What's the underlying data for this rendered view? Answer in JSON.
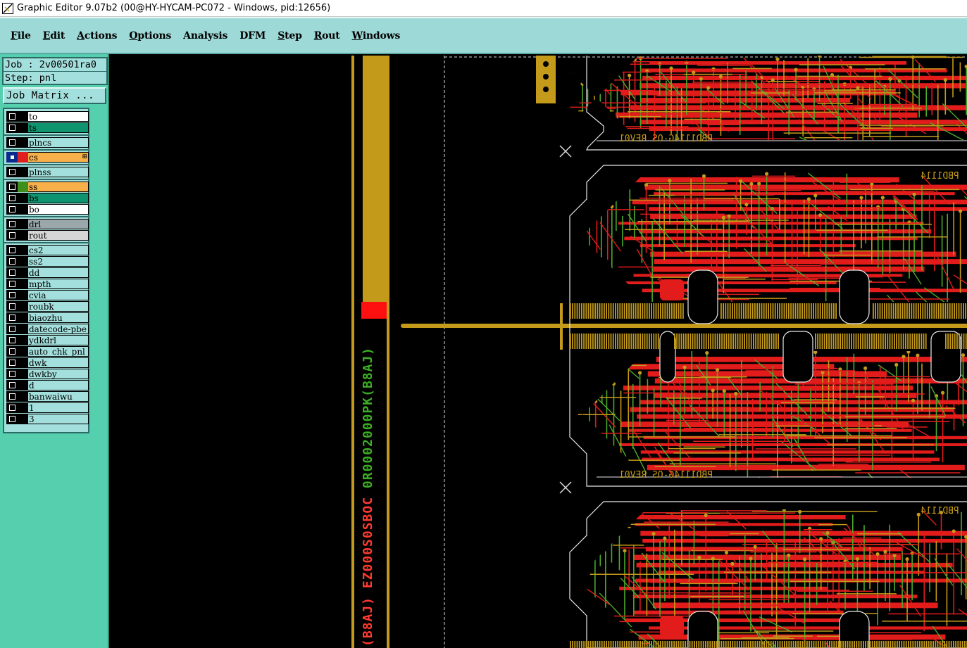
{
  "window": {
    "title": "Graphic Editor 9.07b2 (00@HY-HYCAM-PC072 - Windows, pid:12656)"
  },
  "menu": [
    {
      "first": "F",
      "rest": "ile"
    },
    {
      "first": "E",
      "rest": "dit"
    },
    {
      "first": "A",
      "rest": "ctions"
    },
    {
      "first": "O",
      "rest": "ptions"
    },
    {
      "first": "A",
      "rest": "nalysis"
    },
    {
      "first": "D",
      "rest": "FM"
    },
    {
      "first": "S",
      "rest": "tep"
    },
    {
      "first": "R",
      "rest": "out"
    },
    {
      "first": "W",
      "rest": "indows"
    }
  ],
  "menu_labels": {
    "file": "File",
    "edit": "Edit",
    "actions": "Actions",
    "options": "Options",
    "analysis": "Analysis",
    "dfm": "DFM",
    "step": "Step",
    "rout": "Rout",
    "windows": "Windows"
  },
  "job": {
    "job_line": "Job : 2v00501ra0",
    "step_line": "Step: pnl",
    "matrix_button": "Job Matrix ..."
  },
  "layers": [
    {
      "name": "to",
      "swatch": "#000000",
      "fill": "#ffffff",
      "checked": false
    },
    {
      "name": "ts",
      "swatch": "#000000",
      "fill": "#0f9470",
      "checked": false
    },
    {
      "name": "plncs",
      "swatch": "#000000",
      "fill": "#a3dfdc",
      "checked": false
    },
    {
      "name": "cs",
      "swatch": "#e02020",
      "fill": "#f7b04a",
      "checked": true,
      "marker": "⊞"
    },
    {
      "name": "plnss",
      "swatch": "#000000",
      "fill": "#a3dfdc",
      "checked": false
    },
    {
      "name": "ss",
      "swatch": "#3f8f1c",
      "fill": "#f7b04a",
      "checked": false
    },
    {
      "name": "bs",
      "swatch": "#000000",
      "fill": "#0f9470",
      "checked": false
    },
    {
      "name": "bo",
      "swatch": "#000000",
      "fill": "#ffffff",
      "checked": false
    },
    {
      "name": "drl",
      "swatch": "#000000",
      "fill": "#9aa8ac",
      "checked": false
    },
    {
      "name": "rout",
      "swatch": "#000000",
      "fill": "#d6d6d6",
      "checked": false
    },
    {
      "name": "cs2",
      "swatch": "#000000",
      "fill": "#a3dfdc",
      "checked": false
    },
    {
      "name": "ss2",
      "swatch": "#000000",
      "fill": "#a3dfdc",
      "checked": false
    },
    {
      "name": "dd",
      "swatch": "#000000",
      "fill": "#a3dfdc",
      "checked": false
    },
    {
      "name": "mpth",
      "swatch": "#000000",
      "fill": "#a3dfdc",
      "checked": false
    },
    {
      "name": "cvia",
      "swatch": "#000000",
      "fill": "#a3dfdc",
      "checked": false
    },
    {
      "name": "roubk",
      "swatch": "#000000",
      "fill": "#a3dfdc",
      "checked": false
    },
    {
      "name": "biaozhu",
      "swatch": "#000000",
      "fill": "#a3dfdc",
      "checked": false
    },
    {
      "name": "datecode-pbe",
      "swatch": "#000000",
      "fill": "#a3dfdc",
      "checked": false
    },
    {
      "name": "ydkdrl",
      "swatch": "#000000",
      "fill": "#a3dfdc",
      "checked": false
    },
    {
      "name": "auto_chk_pnl",
      "swatch": "#000000",
      "fill": "#a3dfdc",
      "checked": false
    },
    {
      "name": "dwk",
      "swatch": "#000000",
      "fill": "#a3dfdc",
      "checked": false
    },
    {
      "name": "dwkby",
      "swatch": "#000000",
      "fill": "#a3dfdc",
      "checked": false
    },
    {
      "name": "d",
      "swatch": "#000000",
      "fill": "#a3dfdc",
      "checked": false
    },
    {
      "name": "banwaiwu",
      "swatch": "#000000",
      "fill": "#a3dfdc",
      "checked": false
    },
    {
      "name": "1",
      "swatch": "#000000",
      "fill": "#a3dfdc",
      "checked": false
    },
    {
      "name": "3",
      "swatch": "#000000",
      "fill": "#a3dfdc",
      "checked": false
    }
  ],
  "canvas": {
    "board_labels": [
      "PBD1114G-OS REV01",
      "PBD1114G-OS REV01"
    ],
    "mirror_partial": "PBD1114",
    "vertical_text_red": "(B8AJ) EZ000S0SBOC",
    "vertical_text_green": "0R0002000PK(B8AJ)"
  },
  "colors": {
    "trace_red": "#e21b1b",
    "trace_green": "#4caa2a",
    "trace_gold": "#c39a1a",
    "panel": "#56cfaf",
    "menubar": "#9dd9d6"
  }
}
